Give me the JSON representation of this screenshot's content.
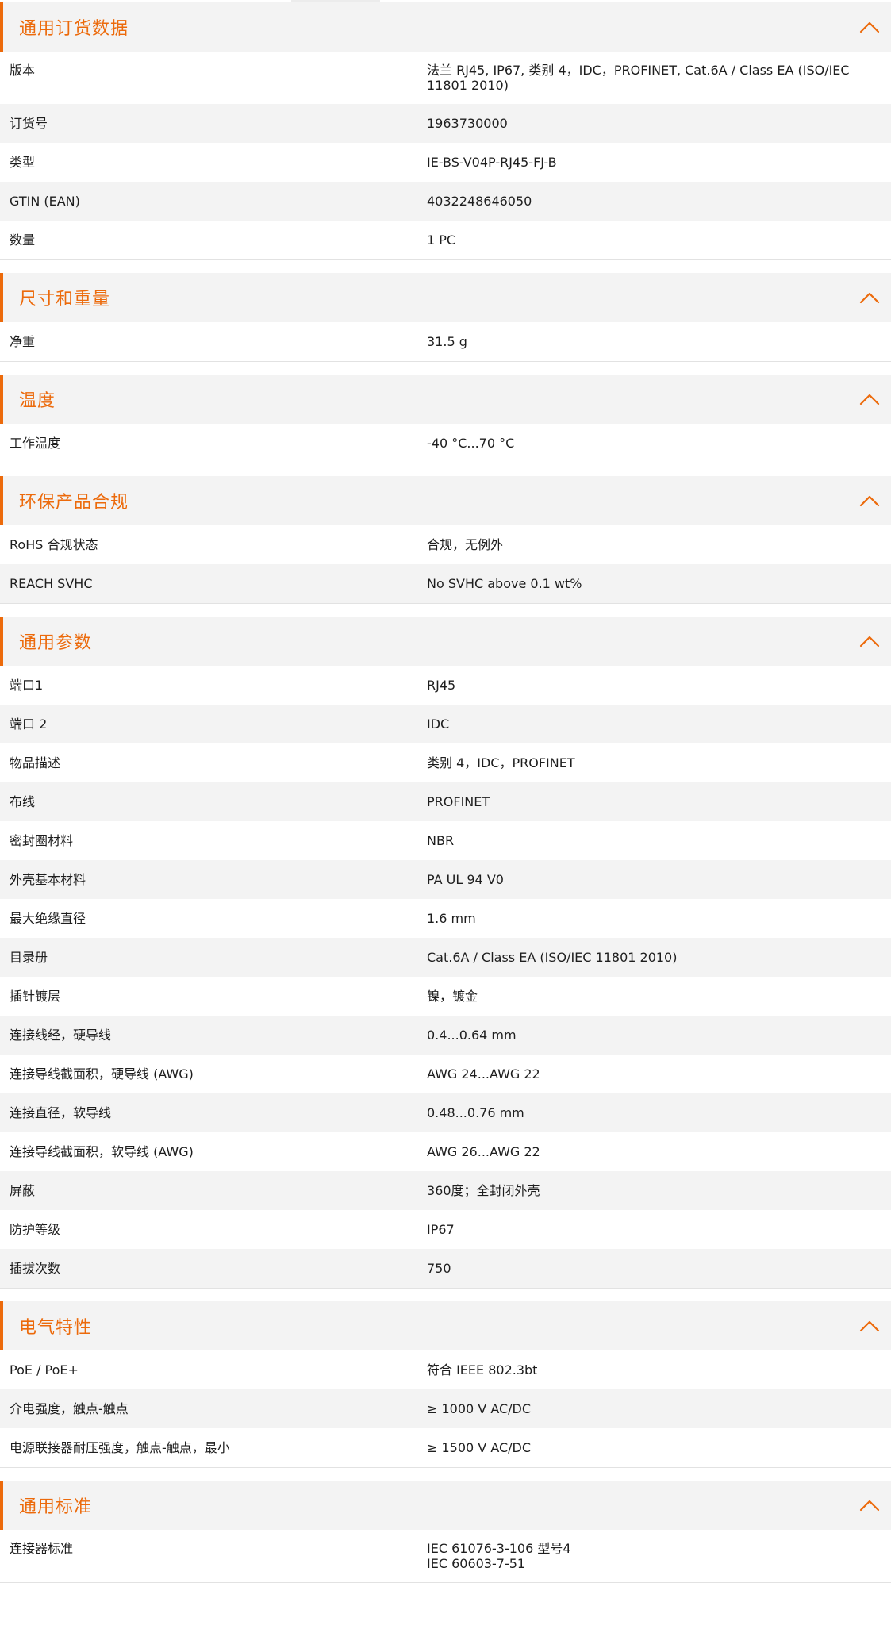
{
  "colors": {
    "accent": "#ec6a0b",
    "header_bg": "#f3f3f3",
    "row_alt_bg": "#f3f3f3"
  },
  "icons": {
    "collapse": "chevron-up-icon"
  },
  "sections": [
    {
      "title": "通用订货数据",
      "rows": [
        {
          "label": "版本",
          "value": [
            "法兰 RJ45, IP67, 类别 4，IDC，PROFINET, Cat.6A / Class EA (ISO/IEC",
            "11801 2010)"
          ]
        },
        {
          "label": "订货号",
          "value": [
            "1963730000"
          ]
        },
        {
          "label": "类型",
          "value": [
            "IE-BS-V04P-RJ45-FJ-B"
          ]
        },
        {
          "label": "GTIN (EAN)",
          "value": [
            "4032248646050"
          ]
        },
        {
          "label": "数量",
          "value": [
            "1  PC"
          ]
        }
      ]
    },
    {
      "title": "尺寸和重量",
      "rows": [
        {
          "label": "净重",
          "value": [
            "31.5  g"
          ]
        }
      ]
    },
    {
      "title": "温度",
      "rows": [
        {
          "label": "工作温度",
          "value": [
            "-40 °C...70 °C"
          ]
        }
      ]
    },
    {
      "title": "环保产品合规",
      "rows": [
        {
          "label": "RoHS 合规状态",
          "value": [
            "合规，无例外"
          ]
        },
        {
          "label": "REACH SVHC",
          "value": [
            "No SVHC above 0.1 wt%"
          ]
        }
      ]
    },
    {
      "title": "通用参数",
      "rows": [
        {
          "label": "端口1",
          "value": [
            "RJ45"
          ]
        },
        {
          "label": "端口 2",
          "value": [
            "IDC"
          ]
        },
        {
          "label": "物品描述",
          "value": [
            "类别 4，IDC，PROFINET"
          ]
        },
        {
          "label": "布线",
          "value": [
            "PROFINET"
          ]
        },
        {
          "label": "密封圈材料",
          "value": [
            "NBR"
          ]
        },
        {
          "label": "外壳基本材料",
          "value": [
            "PA UL 94 V0"
          ]
        },
        {
          "label": "最大绝缘直径",
          "value": [
            "1.6  mm"
          ]
        },
        {
          "label": "目录册",
          "value": [
            "Cat.6A / Class EA (ISO/IEC 11801 2010)"
          ]
        },
        {
          "label": "插针镀层",
          "value": [
            "镍，镀金"
          ]
        },
        {
          "label": "连接线经，硬导线",
          "value": [
            "0.4...0.64 mm"
          ]
        },
        {
          "label": "连接导线截面积，硬导线 (AWG)",
          "value": [
            "AWG 24...AWG 22"
          ]
        },
        {
          "label": "连接直径，软导线",
          "value": [
            "0.48...0.76 mm"
          ]
        },
        {
          "label": "连接导线截面积，软导线 (AWG)",
          "value": [
            "AWG 26...AWG 22"
          ]
        },
        {
          "label": "屏蔽",
          "value": [
            "360度；全封闭外壳"
          ]
        },
        {
          "label": "防护等级",
          "value": [
            "IP67"
          ]
        },
        {
          "label": "插拔次数",
          "value": [
            "750"
          ]
        }
      ]
    },
    {
      "title": "电气特性",
      "rows": [
        {
          "label": "PoE / PoE+",
          "value": [
            "符合 IEEE 802.3bt"
          ]
        },
        {
          "label": "介电强度，触点-触点",
          "value": [
            "≥ 1000 V AC/DC"
          ]
        },
        {
          "label": "电源联接器耐压强度，触点-触点，最小",
          "value": [
            "≥ 1500 V AC/DC"
          ]
        }
      ]
    },
    {
      "title": "通用标准",
      "rows": [
        {
          "label": "连接器标准",
          "value": [
            "IEC 61076-3-106 型号4",
            "IEC 60603-7-51"
          ]
        }
      ]
    }
  ]
}
